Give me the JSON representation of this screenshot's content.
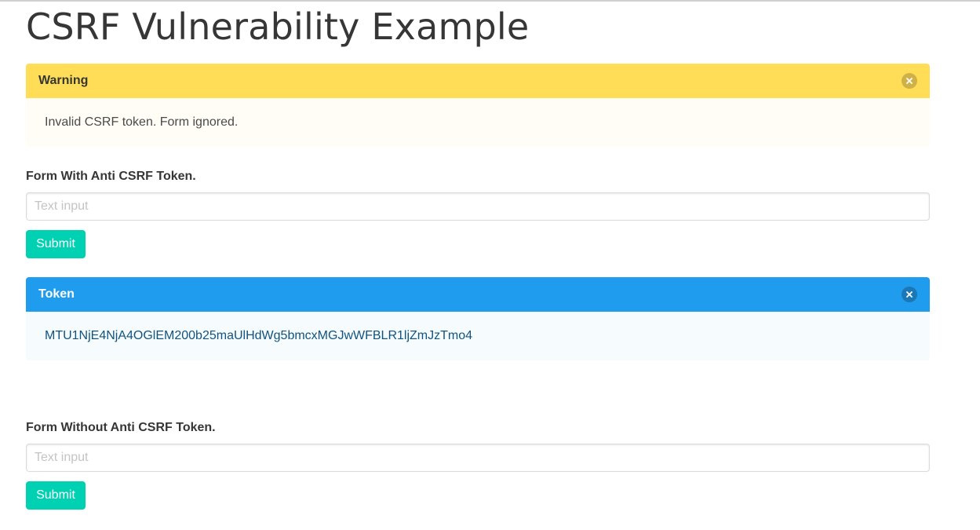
{
  "page": {
    "title": "CSRF Vulnerability Example"
  },
  "warning": {
    "header": "Warning",
    "body": "Invalid CSRF token. Form ignored.",
    "close_icon": "close-circle-icon",
    "color": "#ffdd57"
  },
  "form_with_token": {
    "label": "Form With Anti CSRF Token.",
    "input_placeholder": "Text input",
    "input_value": "",
    "submit_label": "Submit"
  },
  "token": {
    "header": "Token",
    "value": "MTU1NjE4NjA4OGlEM200b25maUlHdWg5bmcxMGJwWFBLR1ljZmJzTmo4",
    "close_icon": "close-circle-icon",
    "color": "#209cee"
  },
  "form_without_token": {
    "label": "Form Without Anti CSRF Token.",
    "input_placeholder": "Text input",
    "input_value": "",
    "submit_label": "Submit"
  },
  "colors": {
    "primary": "#00d1b2",
    "text": "#363636"
  }
}
